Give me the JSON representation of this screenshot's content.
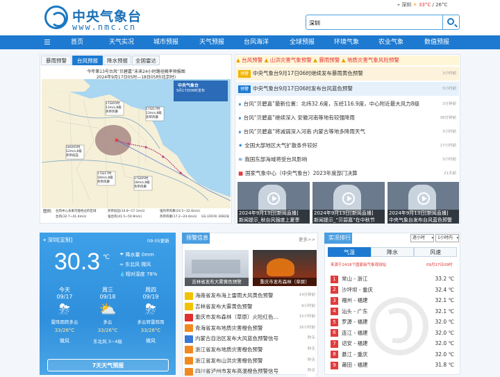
{
  "header": {
    "logo_text": "中央气象台",
    "logo_url": "www.nmc.cn",
    "location": "深圳",
    "temp_high": "33°C",
    "temp_low": "26°C",
    "search_value": "深圳"
  },
  "nav": [
    "首页",
    "天气实况",
    "城市预报",
    "天气预报",
    "台风海洋",
    "全球预报",
    "环境气象",
    "农业气象",
    "数值预报"
  ],
  "map_panel": {
    "tabs": [
      "暴雨预警",
      "台风预报",
      "降水预报",
      "全国雷达"
    ],
    "title1": "今年第13号台风“贝碧嘉”未来24小时路径概率预报图",
    "title2": "2024年9月17日05时—18日05时(北京时)",
    "logo_label1": "中央气象台",
    "logo_label2": "9月17日06时发布",
    "info1": "17日05时\n13m/s,8级\n热带风暴",
    "info2": "17日17时\n13m/s,8级\n热带风暴",
    "info3": "18日05时\n12m/s,6级\n热带低压",
    "info4": "17日17时\n18m/s,8级\n热带风暴",
    "info5": "17日05时\n18m/s,8级\n热带风暴",
    "legend_label": "图例:",
    "legend1": "台风中心未来可能经过的区域",
    "legend2": "热带低压(10.8~17.1m/s)",
    "legend3": "热带风暴(17.2~24.4m/s)",
    "legend4": "强热带风暴(24.5~32.6m/s)",
    "legend5": "台风(32.7~41.4m/s)",
    "legend6": "强台风(41.5~50.9m/s)",
    "credit": "GS (2019) 3082号"
  },
  "alerts": [
    "台风预警",
    "山洪灾害气象预警",
    "暴雨预警",
    "地质灾害气象风险预警"
  ],
  "news": [
    {
      "title": "中央气象台9月17日06时继续发布暴雨黄色预警",
      "time": "3小时前",
      "badge": "预警"
    },
    {
      "title": "中央气象台9月17日06时发布台风蓝色预警",
      "time": "3小时前",
      "badge": "预警"
    },
    {
      "title": "台风“贝碧嘉”最新位置：北纬32.6度，东经116.9度，中心附近最大风力8级",
      "time": "3分钟前"
    },
    {
      "title": "台风“贝碧嘉”继续深入 安徽河南等地有较强降雨",
      "time": "38分钟前"
    },
    {
      "title": "台风“贝碧嘉”将减弱深入河南 内蒙古等地多降雨天气",
      "time": "3小时前"
    },
    {
      "title": "全国大部地区大气扩散条件较好",
      "time": "17小时前"
    },
    {
      "title": "我国东部海域将受台风影响",
      "time": "3小时前"
    },
    {
      "title": "国家气象中心（中央气象台）2023年度部门决算",
      "time": "21天前"
    }
  ],
  "videos": [
    {
      "cap1": "2024年9月13日[新闻直播]",
      "cap2": "新闻提示_秋台风强度上夏季"
    },
    {
      "cap1": "2024年9月13日[新闻直播]",
      "cap2": "新闻提示_“贝碧嘉”在中秋节"
    },
    {
      "cap1": "2024年9月13日[新闻直播]",
      "cap2": "中央气象台发布台风蓝色预警"
    }
  ],
  "weather": {
    "city": "深圳[定制]",
    "time": "09:05更新",
    "temp": "30.3",
    "unit": "℃",
    "rain": "降水量 0mm",
    "wind": "东北风 微风",
    "humidity": "相对湿度 78%",
    "days": [
      {
        "d": "今天",
        "date": "09/17",
        "desc": "雷阵雨转多云",
        "temp": "33/26°C",
        "wind": "微风"
      },
      {
        "d": "周三",
        "date": "09/18",
        "desc": "多云",
        "temp": "33/26°C",
        "wind": "东北风 3~4级"
      },
      {
        "d": "周四",
        "date": "09/19",
        "desc": "多云转雷阵雨",
        "temp": "33/26°C",
        "wind": "微风"
      }
    ],
    "btn": "7天天气预报"
  },
  "warnings": {
    "title": "预警信息",
    "more": "更多>>",
    "photos": [
      {
        "cap": "吉林省发布大雾黄色预警"
      },
      {
        "cap": "重庆市发布森林（草原）"
      }
    ],
    "items": [
      {
        "t": "海南省发布海上雷雨大风黄色预警",
        "time": "14分钟前",
        "c": "#f2c200"
      },
      {
        "t": "吉林省发布大雾黄色预警",
        "time": "9小时前",
        "c": "#f2c200"
      },
      {
        "t": "重庆市发布森林（草原）火险红色...",
        "time": "15小时前",
        "c": "#e03030"
      },
      {
        "t": "青海省发布地质灾害橙色预警",
        "time": "16小时前",
        "c": "#f08a20"
      },
      {
        "t": "内蒙古自治区发布大风蓝色预警信号",
        "time": "昨天",
        "c": "#3a78d8"
      },
      {
        "t": "浙江省发布地质灾害橙色预警",
        "time": "昨天",
        "c": "#f08a20"
      },
      {
        "t": "浙江省发布山洪灾害橙色预警",
        "time": "昨天",
        "c": "#f08a20"
      },
      {
        "t": "四川省泸州市发布高温橙色预警信号",
        "time": "昨天",
        "c": "#f08a20"
      }
    ]
  },
  "ranking": {
    "title": "实况排行",
    "select1": "逐小时",
    "select2": "1小时内",
    "tabs": [
      "气温",
      "降水",
      "风速"
    ],
    "sub": "来源于2418个国家级气象观测站",
    "subtime": "09月17日09时",
    "rows": [
      {
        "n": "1",
        "city": "常山 - 浙江",
        "v": "33.2 ℃"
      },
      {
        "n": "2",
        "city": "沙坪坝 - 重庆",
        "v": "32.4 ℃"
      },
      {
        "n": "3",
        "city": "福州 - 福建",
        "v": "32.1 ℃"
      },
      {
        "n": "4",
        "city": "汕头 - 广东",
        "v": "32.1 ℃"
      },
      {
        "n": "5",
        "city": "罗源 - 福建",
        "v": "32.0 ℃"
      },
      {
        "n": "6",
        "city": "连江 - 福建",
        "v": "32.0 ℃"
      },
      {
        "n": "7",
        "city": "诏安 - 福建",
        "v": "32.0 ℃"
      },
      {
        "n": "8",
        "city": "綦江 - 重庆",
        "v": "32.0 ℃"
      },
      {
        "n": "9",
        "city": "莆田 - 福建",
        "v": "31.8 ℃"
      }
    ]
  }
}
